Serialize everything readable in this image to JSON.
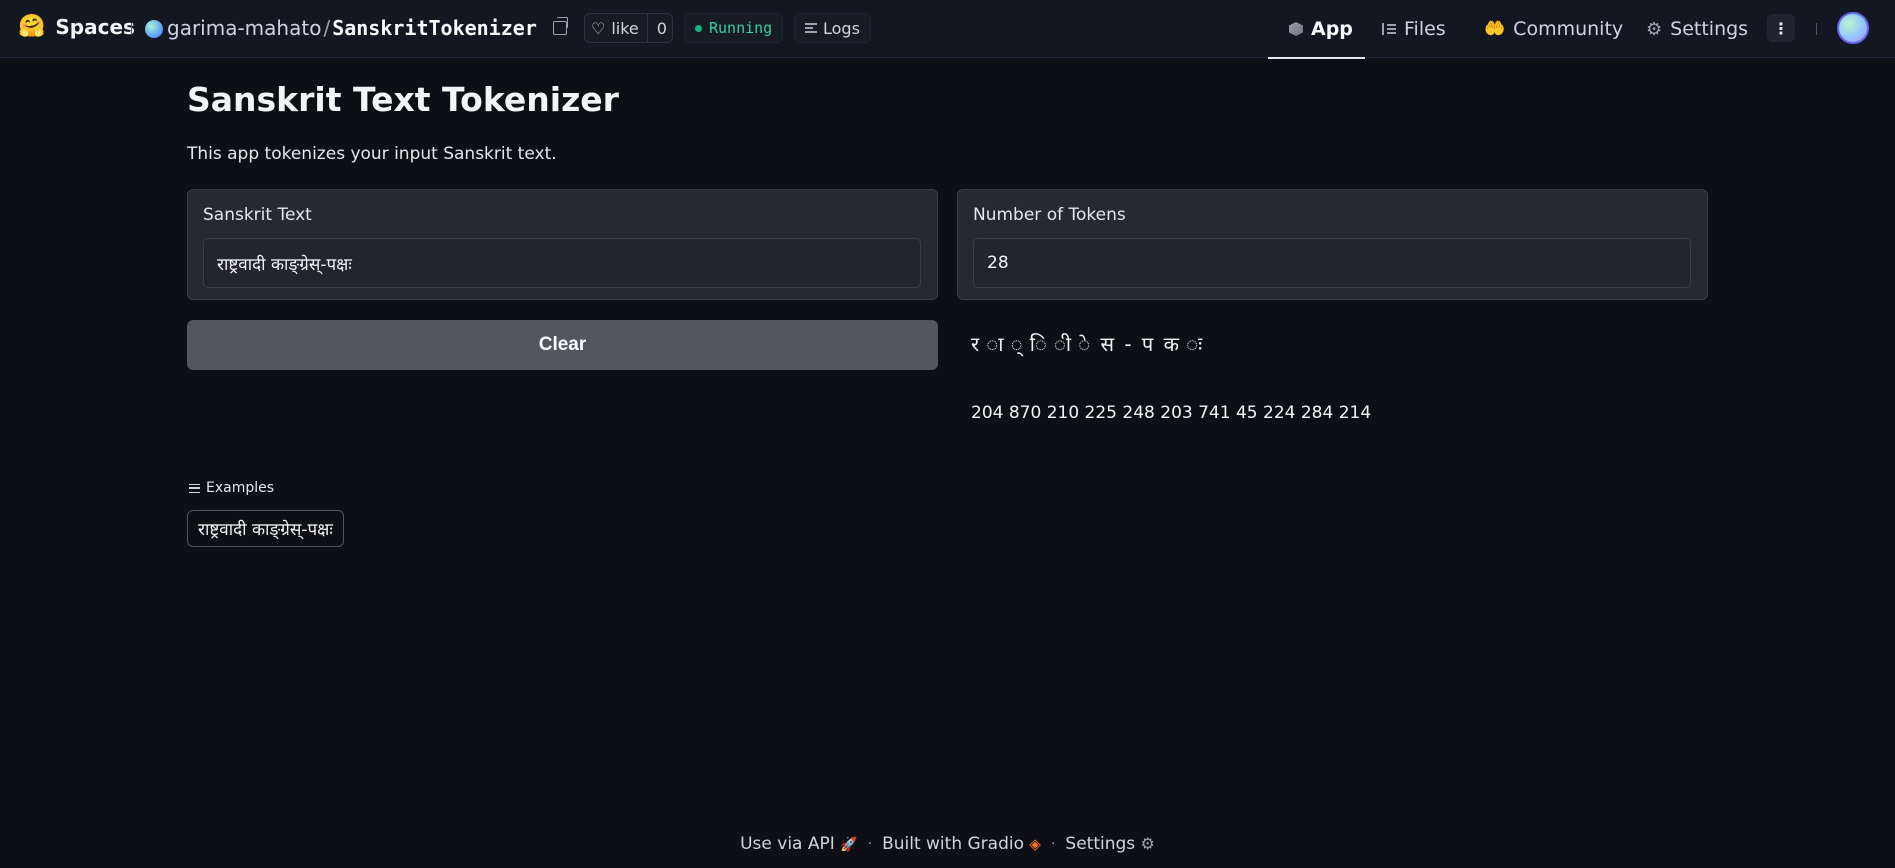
{
  "header": {
    "brand": "Spaces",
    "owner": "garima-mahato",
    "slash": "/",
    "repo": "SanskritTokenizer",
    "like_label": "like",
    "like_count": "0",
    "status": "Running",
    "logs_label": "Logs",
    "nav": {
      "app": "App",
      "files": "Files",
      "community": "Community",
      "settings": "Settings"
    },
    "more_label": "⋮"
  },
  "main": {
    "title": "Sanskrit Text Tokenizer",
    "description": "This app tokenizes your input Sanskrit text.",
    "input_label": "Sanskrit Text",
    "input_value": "राष्ट्रवादी काङ्ग्रेस्-पक्षः",
    "tokens_label": "Number of Tokens",
    "tokens_value": "28",
    "clear_label": "Clear",
    "token_text": "र ा ् ि ी े स - प क ः",
    "token_ids": "204 870 210 225 248 203 741 45 224 284 214",
    "examples_label": "Examples",
    "example_item": "राष्ट्रवादी काङ्ग्रेस्-पक्षः"
  },
  "footer": {
    "api": "Use via API",
    "gradio": "Built with Gradio",
    "settings": "Settings",
    "separator": "·"
  },
  "colors": {
    "background": "#0d0f14",
    "topbar": "#131722",
    "card": "#272830",
    "button": "#54555f",
    "status_green": "#34d399"
  }
}
